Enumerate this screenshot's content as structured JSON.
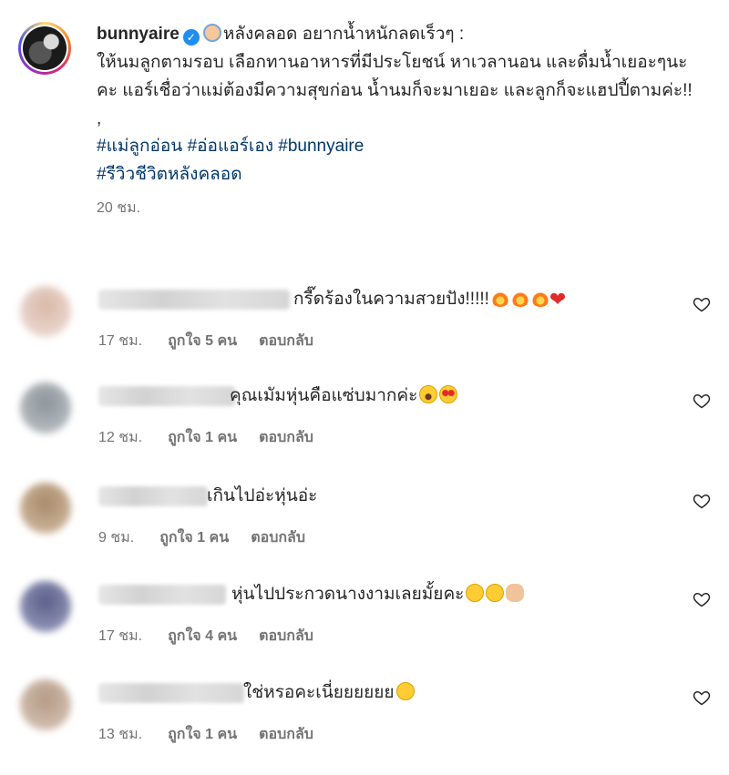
{
  "post": {
    "username": "bunnyaire",
    "caption_line1": "หลังคลอด อยากน้ำหนักลดเร็วๆ :",
    "caption_body": "ให้นมลูกตามรอบ เลือกทานอาหารที่มีประโยชน์ หาเวลานอน และดื่มน้ำเยอะๆนะคะ แอร์เชื่อว่าแม่ต้องมีความสุขก่อน น้ำนมก็จะมาเยอะ และลูกก็จะแฮปปี้ตามค่ะ!!",
    "separator": ",",
    "hashtags_line1": "#แม่ลูกอ่อน #อ่อแอร์เอง #bunnyaire",
    "hashtags_line2": "#รีวิวชีวิตหลังคลอด",
    "time": "20 ชม."
  },
  "comments": [
    {
      "text": "กรี๊ดร้องในความสวยปัง!!!!!",
      "time": "17 ชม.",
      "likes": "ถูกใจ 5 คน",
      "reply": "ตอบกลับ",
      "emojis": [
        "fire",
        "fire",
        "fire",
        "heart"
      ]
    },
    {
      "text": "คุณเมัมหุ่นคือแซ่บมากค่ะ",
      "time": "12 ชม.",
      "likes": "ถูกใจ 1 คน",
      "reply": "ตอบกลับ",
      "emojis": [
        "wow",
        "love"
      ]
    },
    {
      "text": "เกินไปอ่ะหุ่นอ่ะ",
      "time": "9 ชม.",
      "likes": "ถูกใจ 1 คน",
      "reply": "ตอบกลับ",
      "emojis": []
    },
    {
      "text": "หุ่นไปประกวดนางงามเลยมั้ยคะ",
      "time": "17 ชม.",
      "likes": "ถูกใจ 4 คน",
      "reply": "ตอบกลับ",
      "emojis": [
        "smirk",
        "laugh",
        "hand"
      ]
    },
    {
      "text": "ใช่หรอคะเนี่ยยยยยย",
      "time": "13 ชม.",
      "likes": "ถูกใจ 1 คน",
      "reply": "ตอบกลับ",
      "emojis": [
        "laugh"
      ]
    }
  ],
  "icons": {
    "heart": "heart-outline-icon",
    "verified": "verified-badge-icon",
    "emoji_baby": "baby-emoji-icon"
  },
  "colors": {
    "hashtag": "#00376b",
    "verified": "#1f8ef1",
    "muted": "#737373"
  }
}
